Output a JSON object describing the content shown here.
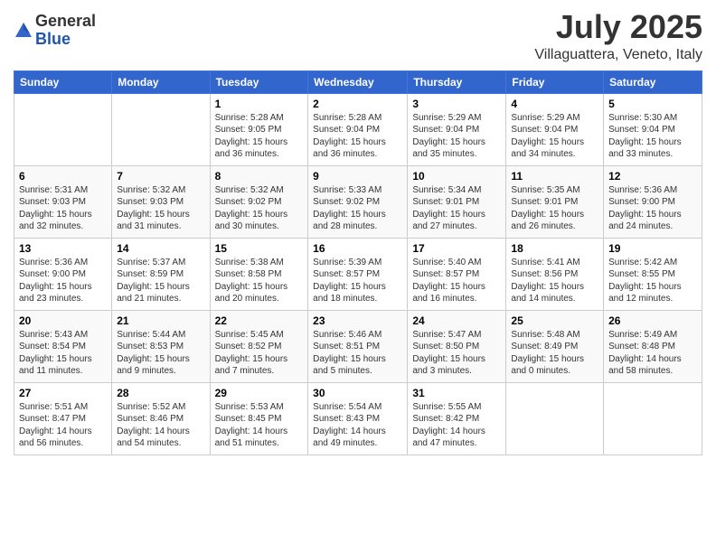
{
  "header": {
    "logo_general": "General",
    "logo_blue": "Blue",
    "month": "July 2025",
    "location": "Villaguattera, Veneto, Italy"
  },
  "weekdays": [
    "Sunday",
    "Monday",
    "Tuesday",
    "Wednesday",
    "Thursday",
    "Friday",
    "Saturday"
  ],
  "weeks": [
    [
      {
        "day": "",
        "info": ""
      },
      {
        "day": "",
        "info": ""
      },
      {
        "day": "1",
        "info": "Sunrise: 5:28 AM\nSunset: 9:05 PM\nDaylight: 15 hours and 36 minutes."
      },
      {
        "day": "2",
        "info": "Sunrise: 5:28 AM\nSunset: 9:04 PM\nDaylight: 15 hours and 36 minutes."
      },
      {
        "day": "3",
        "info": "Sunrise: 5:29 AM\nSunset: 9:04 PM\nDaylight: 15 hours and 35 minutes."
      },
      {
        "day": "4",
        "info": "Sunrise: 5:29 AM\nSunset: 9:04 PM\nDaylight: 15 hours and 34 minutes."
      },
      {
        "day": "5",
        "info": "Sunrise: 5:30 AM\nSunset: 9:04 PM\nDaylight: 15 hours and 33 minutes."
      }
    ],
    [
      {
        "day": "6",
        "info": "Sunrise: 5:31 AM\nSunset: 9:03 PM\nDaylight: 15 hours and 32 minutes."
      },
      {
        "day": "7",
        "info": "Sunrise: 5:32 AM\nSunset: 9:03 PM\nDaylight: 15 hours and 31 minutes."
      },
      {
        "day": "8",
        "info": "Sunrise: 5:32 AM\nSunset: 9:02 PM\nDaylight: 15 hours and 30 minutes."
      },
      {
        "day": "9",
        "info": "Sunrise: 5:33 AM\nSunset: 9:02 PM\nDaylight: 15 hours and 28 minutes."
      },
      {
        "day": "10",
        "info": "Sunrise: 5:34 AM\nSunset: 9:01 PM\nDaylight: 15 hours and 27 minutes."
      },
      {
        "day": "11",
        "info": "Sunrise: 5:35 AM\nSunset: 9:01 PM\nDaylight: 15 hours and 26 minutes."
      },
      {
        "day": "12",
        "info": "Sunrise: 5:36 AM\nSunset: 9:00 PM\nDaylight: 15 hours and 24 minutes."
      }
    ],
    [
      {
        "day": "13",
        "info": "Sunrise: 5:36 AM\nSunset: 9:00 PM\nDaylight: 15 hours and 23 minutes."
      },
      {
        "day": "14",
        "info": "Sunrise: 5:37 AM\nSunset: 8:59 PM\nDaylight: 15 hours and 21 minutes."
      },
      {
        "day": "15",
        "info": "Sunrise: 5:38 AM\nSunset: 8:58 PM\nDaylight: 15 hours and 20 minutes."
      },
      {
        "day": "16",
        "info": "Sunrise: 5:39 AM\nSunset: 8:57 PM\nDaylight: 15 hours and 18 minutes."
      },
      {
        "day": "17",
        "info": "Sunrise: 5:40 AM\nSunset: 8:57 PM\nDaylight: 15 hours and 16 minutes."
      },
      {
        "day": "18",
        "info": "Sunrise: 5:41 AM\nSunset: 8:56 PM\nDaylight: 15 hours and 14 minutes."
      },
      {
        "day": "19",
        "info": "Sunrise: 5:42 AM\nSunset: 8:55 PM\nDaylight: 15 hours and 12 minutes."
      }
    ],
    [
      {
        "day": "20",
        "info": "Sunrise: 5:43 AM\nSunset: 8:54 PM\nDaylight: 15 hours and 11 minutes."
      },
      {
        "day": "21",
        "info": "Sunrise: 5:44 AM\nSunset: 8:53 PM\nDaylight: 15 hours and 9 minutes."
      },
      {
        "day": "22",
        "info": "Sunrise: 5:45 AM\nSunset: 8:52 PM\nDaylight: 15 hours and 7 minutes."
      },
      {
        "day": "23",
        "info": "Sunrise: 5:46 AM\nSunset: 8:51 PM\nDaylight: 15 hours and 5 minutes."
      },
      {
        "day": "24",
        "info": "Sunrise: 5:47 AM\nSunset: 8:50 PM\nDaylight: 15 hours and 3 minutes."
      },
      {
        "day": "25",
        "info": "Sunrise: 5:48 AM\nSunset: 8:49 PM\nDaylight: 15 hours and 0 minutes."
      },
      {
        "day": "26",
        "info": "Sunrise: 5:49 AM\nSunset: 8:48 PM\nDaylight: 14 hours and 58 minutes."
      }
    ],
    [
      {
        "day": "27",
        "info": "Sunrise: 5:51 AM\nSunset: 8:47 PM\nDaylight: 14 hours and 56 minutes."
      },
      {
        "day": "28",
        "info": "Sunrise: 5:52 AM\nSunset: 8:46 PM\nDaylight: 14 hours and 54 minutes."
      },
      {
        "day": "29",
        "info": "Sunrise: 5:53 AM\nSunset: 8:45 PM\nDaylight: 14 hours and 51 minutes."
      },
      {
        "day": "30",
        "info": "Sunrise: 5:54 AM\nSunset: 8:43 PM\nDaylight: 14 hours and 49 minutes."
      },
      {
        "day": "31",
        "info": "Sunrise: 5:55 AM\nSunset: 8:42 PM\nDaylight: 14 hours and 47 minutes."
      },
      {
        "day": "",
        "info": ""
      },
      {
        "day": "",
        "info": ""
      }
    ]
  ]
}
